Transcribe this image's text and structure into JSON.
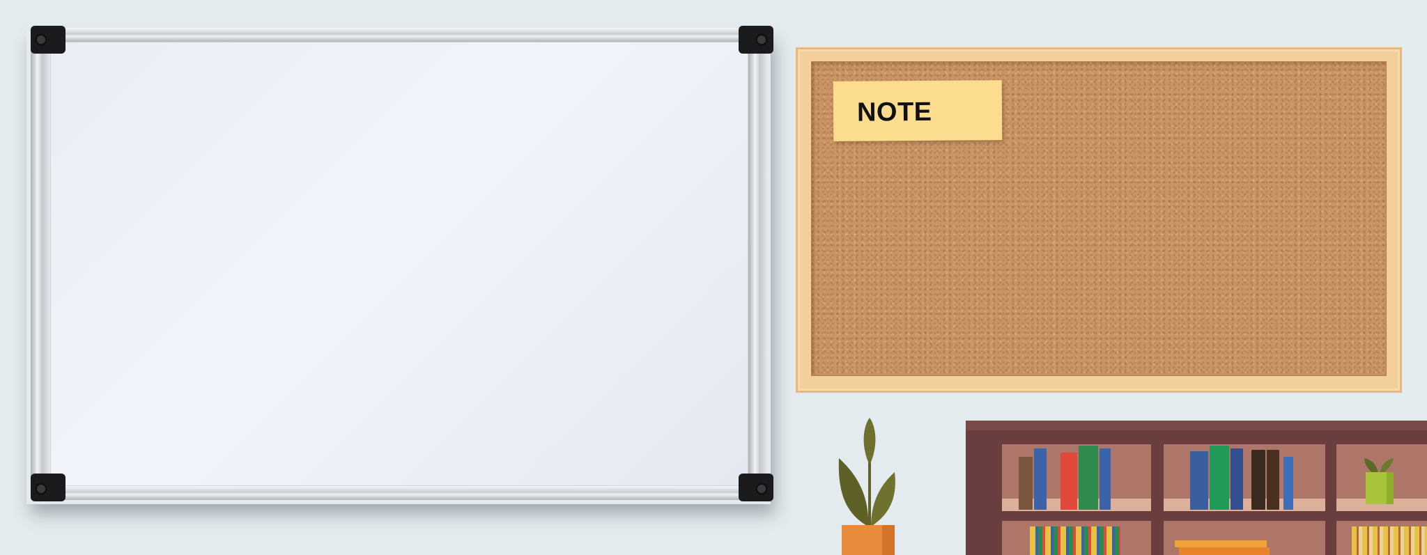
{
  "cork_board": {
    "note_label": "NOTE"
  },
  "colors": {
    "wall": "#e4ebee",
    "whiteboard_surface": "#eef1f7",
    "cork": "#c99466",
    "cork_frame": "#f2cf9b",
    "note": "#fcdc8e",
    "pot": "#e88b3a",
    "leaf": "#6b6c2e",
    "shelf": "#6a3e3e"
  },
  "decor": {
    "left_plant": "potted-plant-icon",
    "shelf_plant": "small-plant-icon"
  }
}
